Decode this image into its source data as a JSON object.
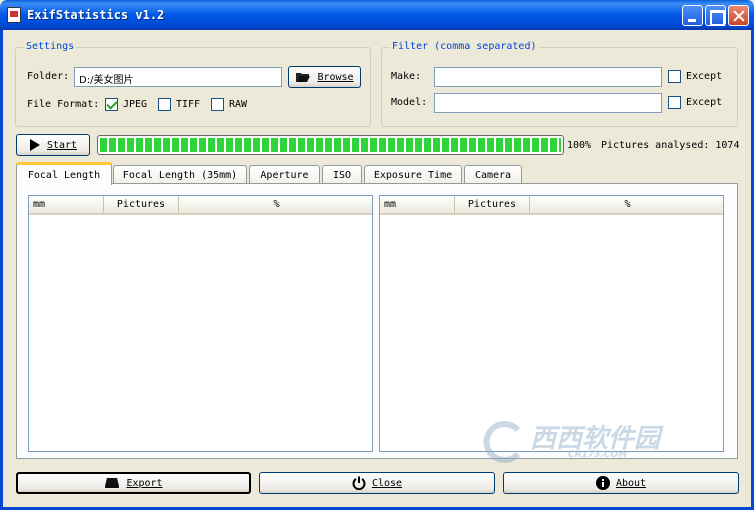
{
  "window": {
    "title": "ExifStatistics v1.2"
  },
  "settings": {
    "title": "Settings",
    "folder_label": "Folder:",
    "folder_value": "D:/美女图片",
    "browse_label": "Browse",
    "format_label": "File Format:",
    "formats": [
      {
        "label": "JPEG",
        "checked": true
      },
      {
        "label": "TIFF",
        "checked": false
      },
      {
        "label": "RAW",
        "checked": false
      }
    ]
  },
  "filter": {
    "title": "Filter (comma separated)",
    "make_label": "Make:",
    "make_value": "",
    "model_label": "Model:",
    "model_value": "",
    "except_label": "Except"
  },
  "run": {
    "start_label": "Start",
    "progress_percent": 100,
    "progress_text": "100%",
    "status_text": "Pictures analysed: 1074"
  },
  "tabs": [
    {
      "label": "Focal Length",
      "active": true
    },
    {
      "label": "Focal Length (35mm)",
      "active": false
    },
    {
      "label": "Aperture",
      "active": false
    },
    {
      "label": "ISO",
      "active": false
    },
    {
      "label": "Exposure Time",
      "active": false
    },
    {
      "label": "Camera",
      "active": false
    }
  ],
  "table_left": {
    "columns": [
      "mm",
      "Pictures",
      "%"
    ]
  },
  "table_right": {
    "columns": [
      "mm",
      "Pictures",
      "%"
    ]
  },
  "footer": {
    "export_label": "Export",
    "close_label": "Close",
    "about_label": "About"
  },
  "watermark": {
    "main": "西西软件园",
    "sub": "CR173.COM"
  }
}
